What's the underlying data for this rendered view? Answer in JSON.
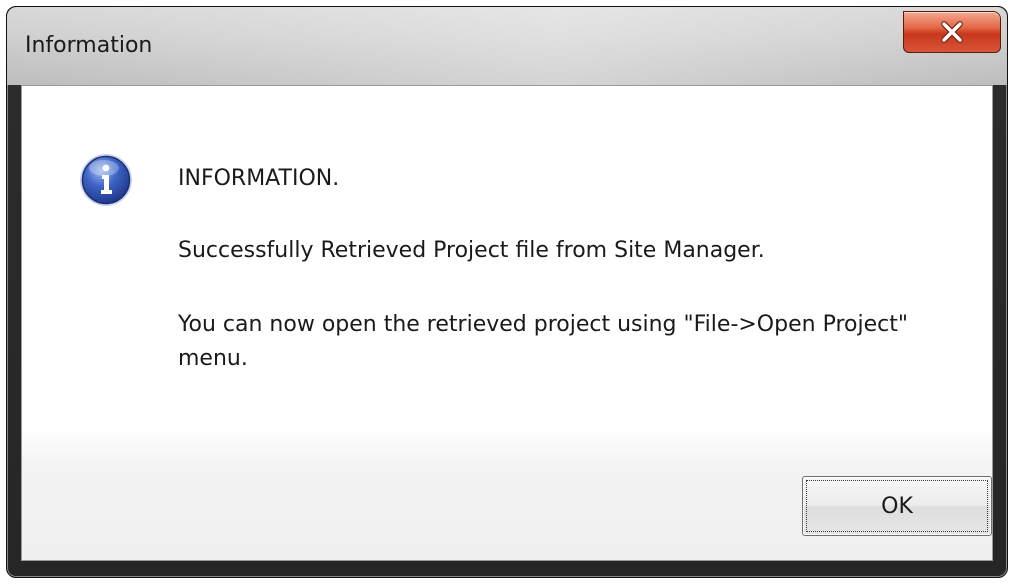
{
  "window": {
    "title": "Information"
  },
  "icons": {
    "close": "close-icon",
    "info": "info-icon"
  },
  "message": {
    "heading": "INFORMATION.",
    "line1": "Successfully Retrieved Project file from Site Manager.",
    "line2": "You can now open the retrieved project using \"File->Open Project\" menu."
  },
  "buttons": {
    "ok_label": "OK"
  },
  "colors": {
    "close_button": "#d9553a",
    "info_icon_blue": "#2a4fb0"
  }
}
